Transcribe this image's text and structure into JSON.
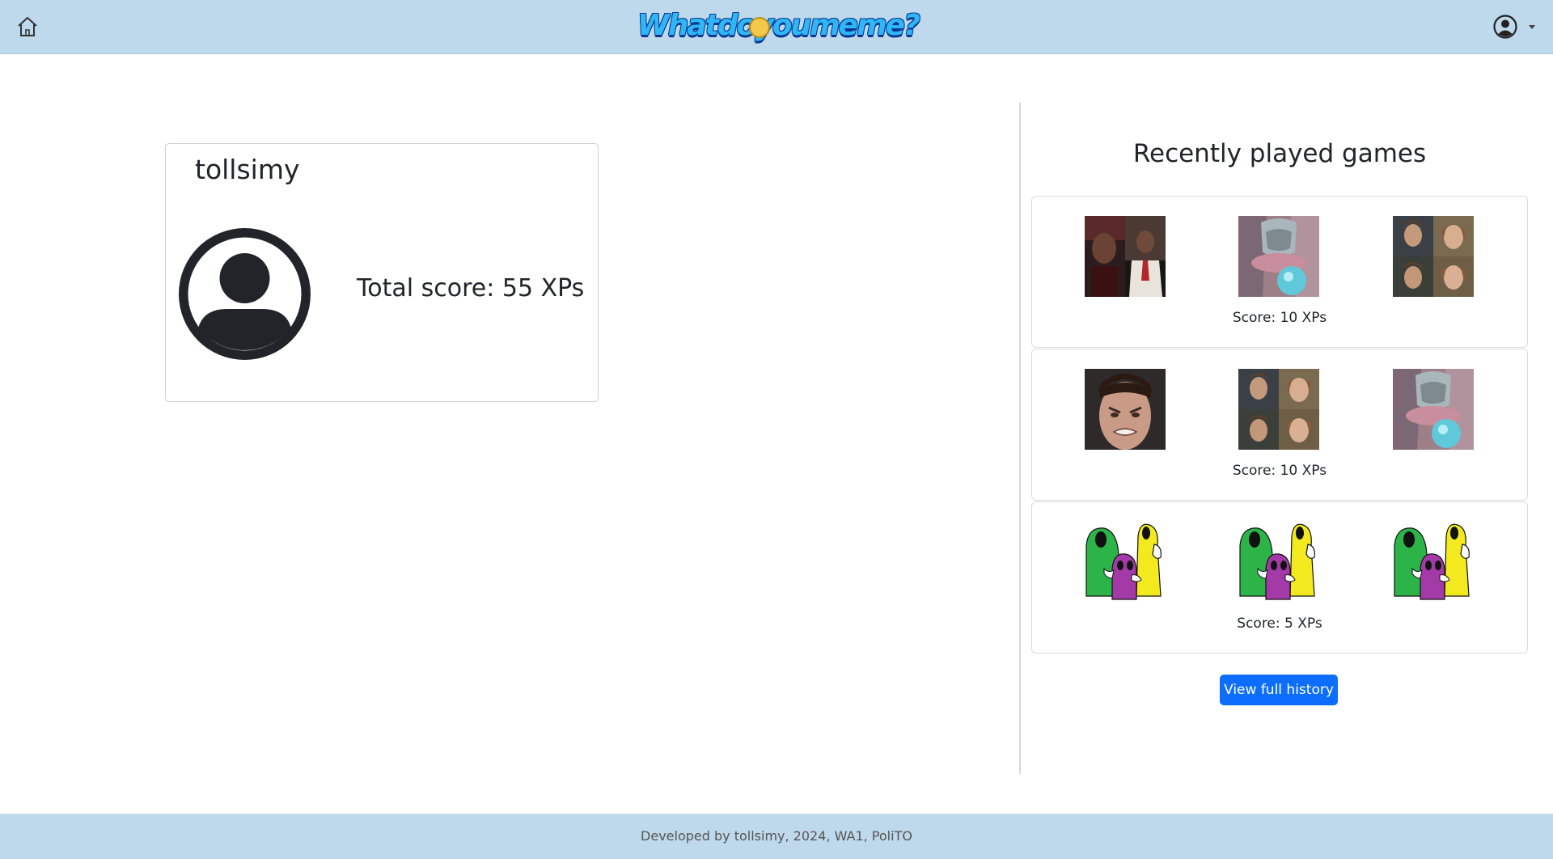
{
  "header": {
    "logo_text": "Whatdoyoumeme?",
    "home_icon": "home-icon",
    "user_icon": "user-circle-icon"
  },
  "profile": {
    "username": "tollsimy",
    "total_score": "Total score: 55 XPs",
    "avatar_icon": "person-circle-icon"
  },
  "recent": {
    "title": "Recently played games",
    "games": [
      {
        "score": "Score: 10 XPs",
        "memes": [
          "two-men-meme",
          "crystal-ball-meme",
          "anakin-padme-meme"
        ]
      },
      {
        "score": "Score: 10 XPs",
        "memes": [
          "angry-face-meme",
          "anakin-padme-meme",
          "crystal-ball-meme"
        ]
      },
      {
        "score": "Score: 5 XPs",
        "memes": [
          "three-ghosts-meme",
          "three-ghosts-meme",
          "three-ghosts-meme"
        ]
      }
    ],
    "view_history_label": "View full history"
  },
  "footer": {
    "text": "Developed by tollsimy, 2024, WA1, PoliTO"
  },
  "colors": {
    "navbar_bg": "#bfd9ec",
    "primary_button": "#0d6efd",
    "text": "#212529"
  }
}
